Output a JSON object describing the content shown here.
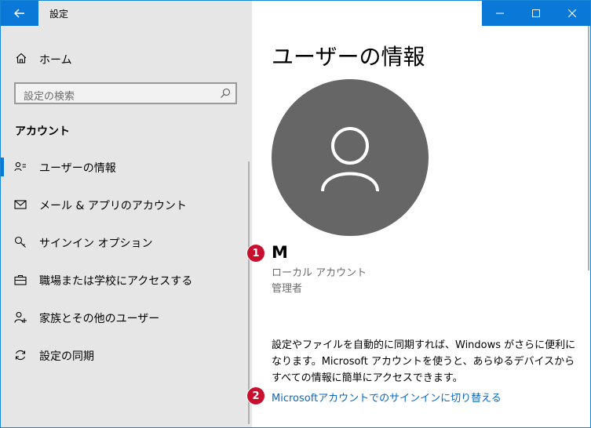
{
  "window": {
    "title": "設定",
    "accent": "#0a78d7"
  },
  "sidebar": {
    "home_label": "ホーム",
    "search_placeholder": "設定の検索",
    "section_title": "アカウント",
    "items": [
      {
        "label": "ユーザーの情報",
        "icon": "user-card-icon",
        "active": true
      },
      {
        "label": "メール & アプリのアカウント",
        "icon": "mail-icon",
        "active": false
      },
      {
        "label": "サインイン オプション",
        "icon": "key-icon",
        "active": false
      },
      {
        "label": "職場または学校にアクセスする",
        "icon": "briefcase-icon",
        "active": false
      },
      {
        "label": "家族とその他のユーザー",
        "icon": "add-user-icon",
        "active": false
      },
      {
        "label": "設定の同期",
        "icon": "sync-icon",
        "active": false
      }
    ]
  },
  "main": {
    "page_title": "ユーザーの情報",
    "user_name": "M",
    "account_type": "ローカル アカウント",
    "account_role": "管理者",
    "description": "設定やファイルを自動的に同期すれば、Windows がさらに便利になります。Microsoft アカウントを使うと、あらゆるデバイスからすべての情報に簡単にアクセスできます。",
    "switch_link": "Microsoftアカウントでのサインインに切り替える"
  },
  "annotations": {
    "badge1": "1",
    "badge2": "2",
    "badge_color": "#c8102e"
  }
}
